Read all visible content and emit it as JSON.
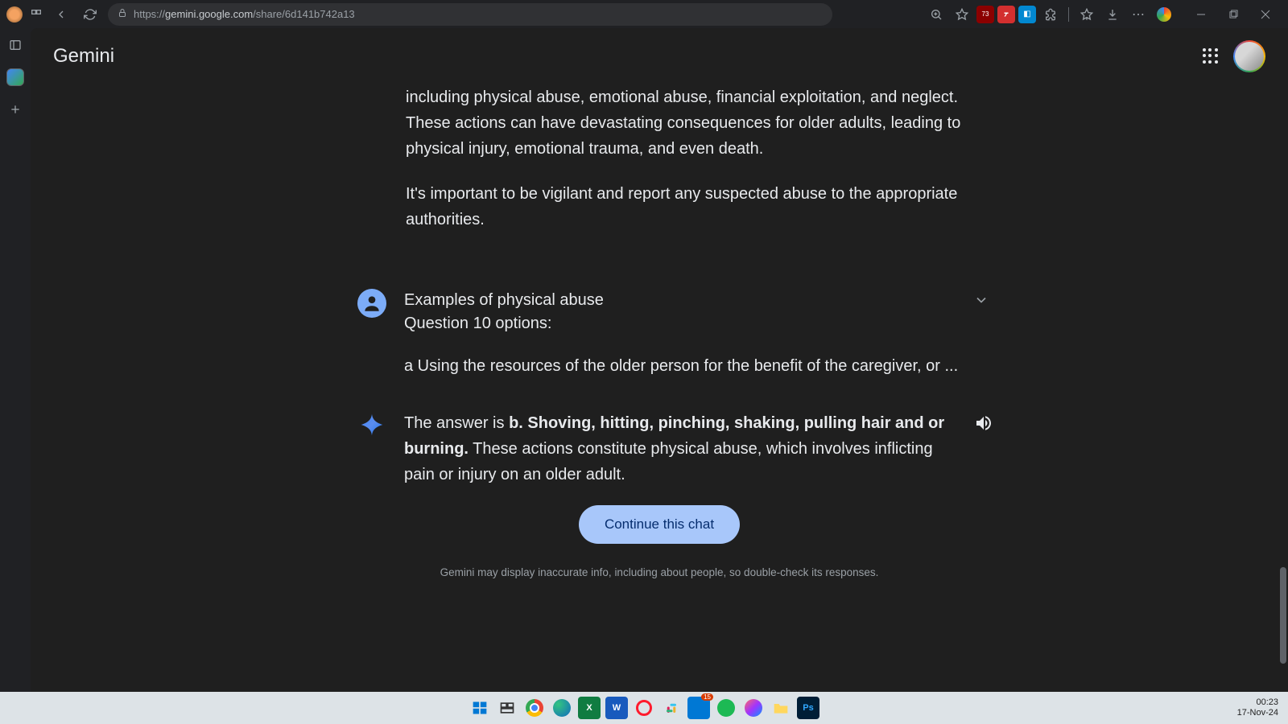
{
  "browser": {
    "url_prefix": "https://",
    "url_domain": "gemini.google.com",
    "url_path": "/share/6d141b742a13"
  },
  "extensions": {
    "ublock_badge": "73"
  },
  "app": {
    "logo": "Gemini"
  },
  "conversation": {
    "prev_response_p1": "including physical abuse, emotional abuse, financial exploitation, and neglect. These actions can have devastating consequences for older adults, leading to physical injury, emotional trauma, and even death.",
    "prev_response_p2": "It's important to be vigilant and report any suspected abuse to the appropriate authorities.",
    "user_line1": "Examples of physical abuse",
    "user_line2": "Question 10 options:",
    "user_line3": "a Using the resources of the older person for the benefit of the caregiver, or ...",
    "answer_prefix": "The answer is ",
    "answer_bold": "b. Shoving, hitting, pinching, shaking, pulling hair and or burning.",
    "answer_rest": " These actions constitute physical abuse, which involves inflicting pain or injury on an older adult."
  },
  "ui": {
    "continue_label": "Continue this chat",
    "disclaimer": "Gemini may display inaccurate info, including about people, so double-check its responses."
  },
  "system": {
    "time": "00:23",
    "date": "17-Nov-24"
  }
}
